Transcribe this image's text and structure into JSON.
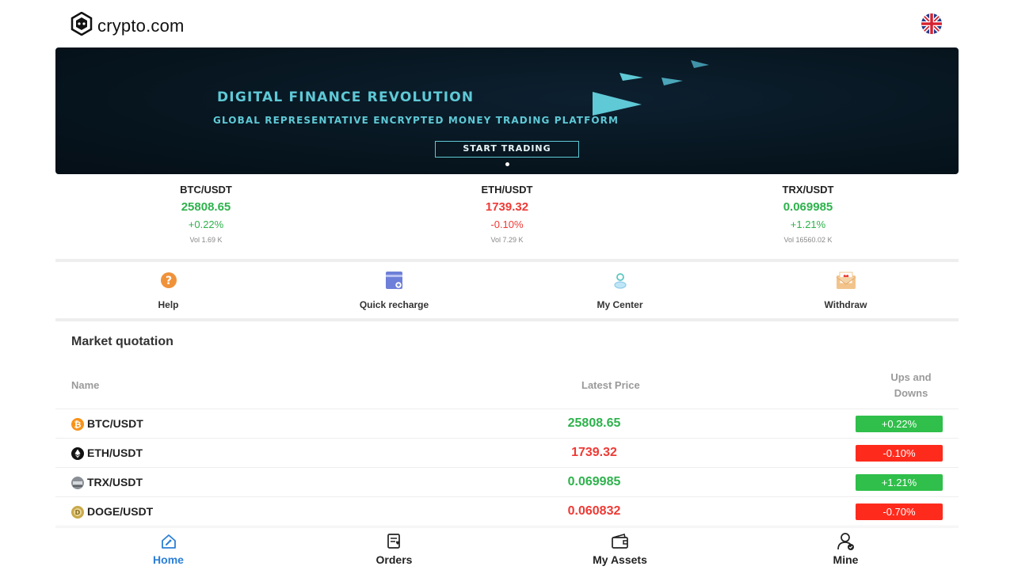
{
  "header": {
    "brand": "crypto.com",
    "logo_icon": "crypto-lion-shield-icon",
    "language_icon": "uk-flag-icon"
  },
  "banner": {
    "title": "DIGITAL FINANCE REVOLUTION",
    "subtitle": "GLOBAL REPRESENTATIVE ENCRYPTED MONEY TRADING PLATFORM",
    "cta": "START TRADING"
  },
  "ticker": [
    {
      "pair": "BTC/USDT",
      "price": "25808.65",
      "change": "+0.22%",
      "vol": "Vol 1.69 K",
      "direction": "up"
    },
    {
      "pair": "ETH/USDT",
      "price": "1739.32",
      "change": "-0.10%",
      "vol": "Vol 7.29 K",
      "direction": "down"
    },
    {
      "pair": "TRX/USDT",
      "price": "0.069985",
      "change": "+1.21%",
      "vol": "Vol 16560.02 K",
      "direction": "up"
    }
  ],
  "shortcuts": [
    {
      "label": "Help",
      "icon": "help-icon"
    },
    {
      "label": "Quick recharge",
      "icon": "recharge-icon"
    },
    {
      "label": "My Center",
      "icon": "user-center-icon"
    },
    {
      "label": "Withdraw",
      "icon": "withdraw-envelope-icon"
    }
  ],
  "market": {
    "title": "Market quotation",
    "headers": {
      "name": "Name",
      "price": "Latest Price",
      "change": "Ups and Downs"
    },
    "rows": [
      {
        "name": "BTC/USDT",
        "price": "25808.65",
        "change": "+0.22%",
        "direction": "up",
        "icon": "bitcoin-icon"
      },
      {
        "name": "ETH/USDT",
        "price": "1739.32",
        "change": "-0.10%",
        "direction": "down",
        "icon": "ethereum-icon"
      },
      {
        "name": "TRX/USDT",
        "price": "0.069985",
        "change": "+1.21%",
        "direction": "up",
        "icon": "tron-icon"
      },
      {
        "name": "DOGE/USDT",
        "price": "0.060832",
        "change": "-0.70%",
        "direction": "down",
        "icon": "dogecoin-icon"
      }
    ]
  },
  "bottom_nav": [
    {
      "label": "Home",
      "icon": "home-icon",
      "active": true
    },
    {
      "label": "Orders",
      "icon": "orders-icon",
      "active": false
    },
    {
      "label": "My Assets",
      "icon": "wallet-icon",
      "active": false
    },
    {
      "label": "Mine",
      "icon": "profile-icon",
      "active": false
    }
  ],
  "colors": {
    "up": "#2eb24c",
    "down": "#ee3a35",
    "active_nav": "#2b7fd6",
    "banner_text": "#5fc9d6"
  }
}
